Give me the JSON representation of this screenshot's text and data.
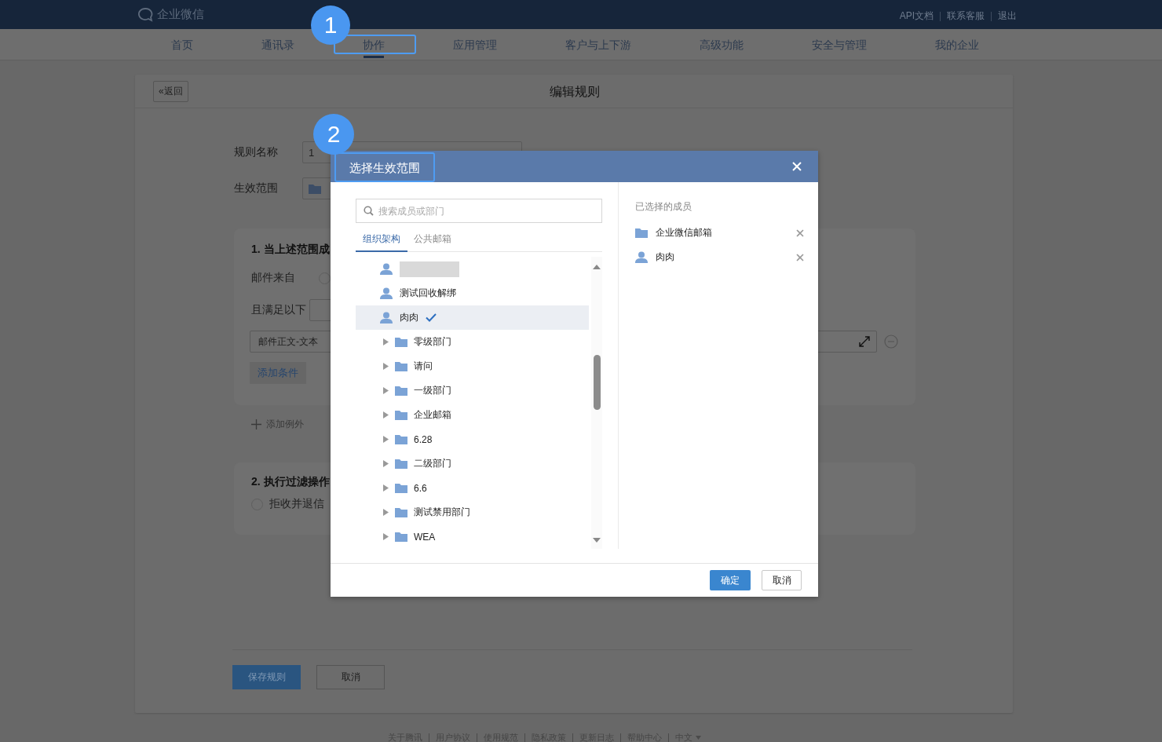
{
  "header": {
    "logo": "企业微信",
    "links": [
      "API文档",
      "联系客服",
      "退出"
    ]
  },
  "nav": [
    {
      "label": "首页",
      "selected": false
    },
    {
      "label": "通讯录",
      "selected": false
    },
    {
      "label": "协作",
      "selected": true,
      "annotation": "1"
    },
    {
      "label": "应用管理",
      "selected": false
    },
    {
      "label": "客户与上下游",
      "selected": false
    },
    {
      "label": "高级功能",
      "selected": false
    },
    {
      "label": "安全与管理",
      "selected": false
    },
    {
      "label": "我的企业",
      "selected": false
    }
  ],
  "page": {
    "back": "«返回",
    "title": "编辑规则",
    "fields": [
      {
        "kind": "text",
        "label": "规则名称",
        "value": "1"
      },
      {
        "kind": "scope",
        "label": "生效范围"
      }
    ],
    "section1": {
      "title": "1. 当上述范围成",
      "from_label": "邮件来自",
      "from_checked": false,
      "cond_label": "且满足以下",
      "condition": "邮件正文-文本",
      "add_condition": "添加条件"
    },
    "add_exception": "添加例外",
    "section2": {
      "title": "2. 执行过滤操作",
      "option": "拒收并退信",
      "checked": false
    },
    "save": "保存规则",
    "cancel": "取消"
  },
  "dialog": {
    "title": "选择生效范围",
    "annotation": "2",
    "search": {
      "placeholder": "搜索成员或部门"
    },
    "tabs": [
      {
        "label": "组织架构",
        "selected": true
      },
      {
        "label": "公共邮箱",
        "selected": false
      }
    ],
    "tree": [
      {
        "kind": "person",
        "redacted": true,
        "selected": false
      },
      {
        "kind": "person",
        "label": "测试回收解绑",
        "redacted": false,
        "selected": false
      },
      {
        "kind": "person",
        "label": "肉肉",
        "redacted": false,
        "selected": true
      },
      {
        "kind": "dept",
        "label": "零级部门",
        "selected": false
      },
      {
        "kind": "dept",
        "label": "请问",
        "selected": false
      },
      {
        "kind": "dept",
        "label": "一级部门",
        "selected": false
      },
      {
        "kind": "dept",
        "label": "企业邮箱",
        "selected": false
      },
      {
        "kind": "dept",
        "label": "6.28",
        "selected": false
      },
      {
        "kind": "dept",
        "label": "二级部门",
        "selected": false
      },
      {
        "kind": "dept",
        "label": "6.6",
        "selected": false
      },
      {
        "kind": "dept",
        "label": "测试禁用部门",
        "selected": false
      },
      {
        "kind": "dept",
        "label": "WEA",
        "selected": false
      }
    ],
    "selected_title": "已选择的成员",
    "selected_items": [
      {
        "kind": "dept",
        "label": "企业微信邮箱"
      },
      {
        "kind": "person",
        "label": "肉肉"
      }
    ],
    "ok": "确定",
    "cancel": "取消"
  },
  "footer": [
    "关于腾讯",
    "用户协议",
    "使用规范",
    "隐私政策",
    "更新日志",
    "帮助中心",
    "中文"
  ]
}
